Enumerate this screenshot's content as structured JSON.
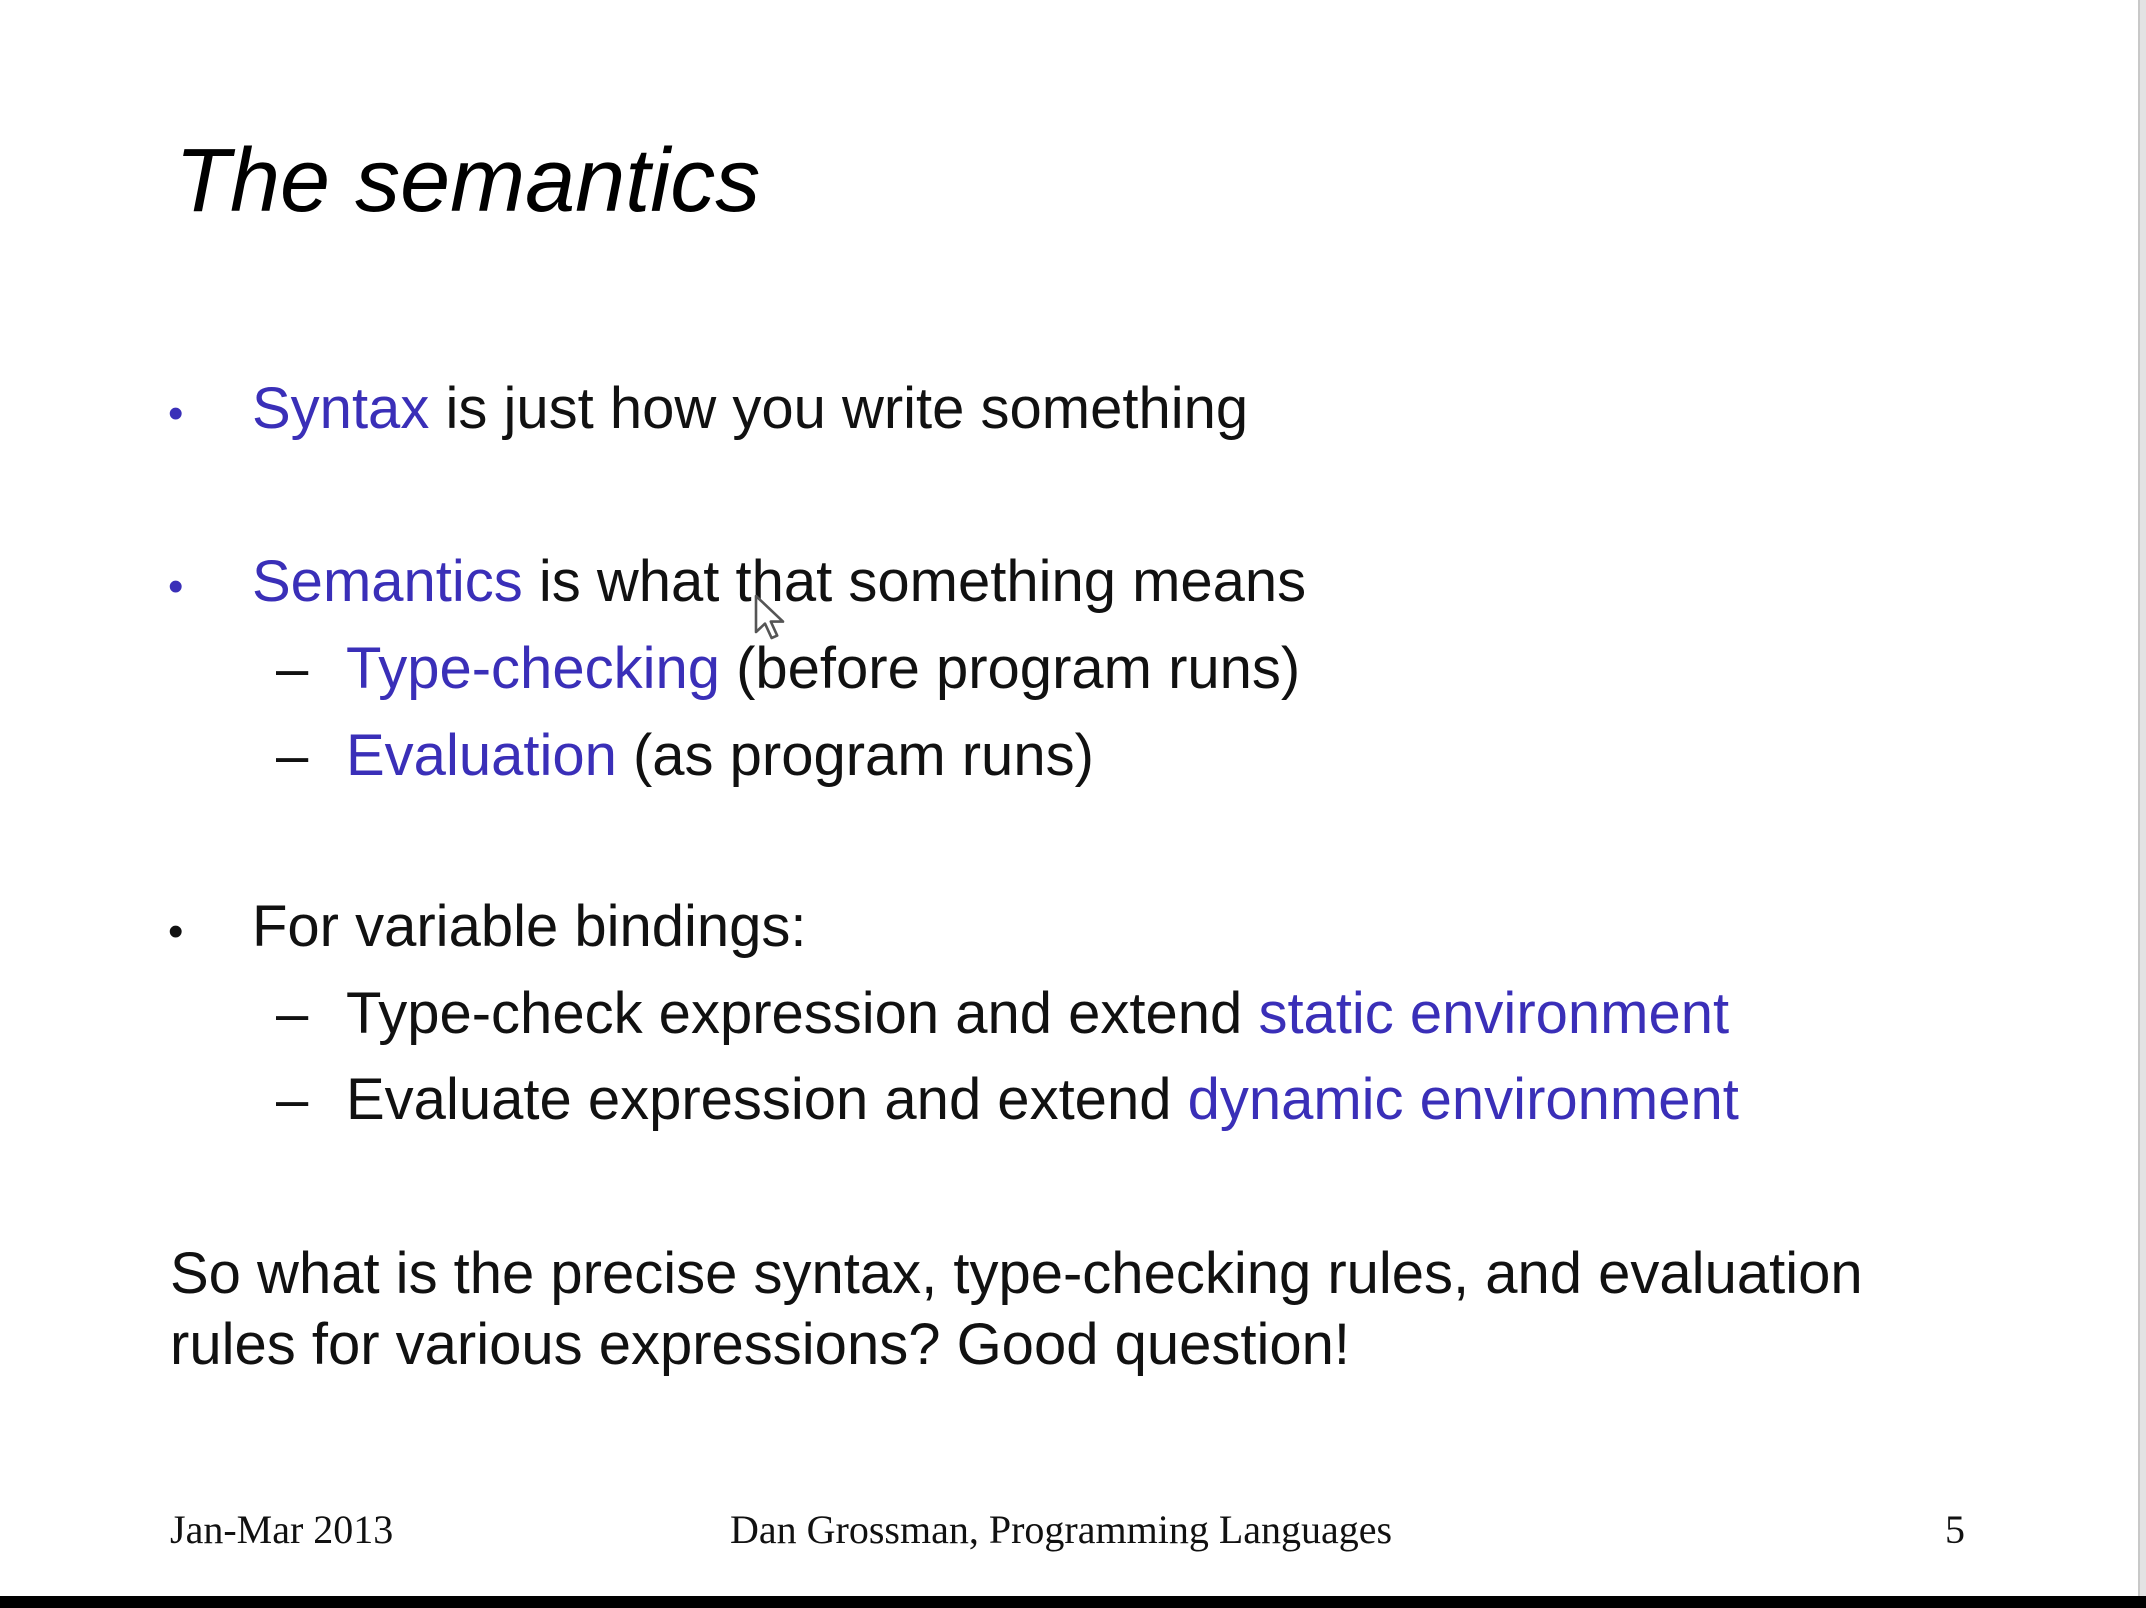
{
  "slide": {
    "title": "The semantics",
    "bullets": [
      {
        "accent_text": "Syntax",
        "rest_text": " is just how you write something"
      },
      {
        "accent_text": "Semantics",
        "rest_text": " is what that something means",
        "subitems": [
          {
            "accent_text": "Type-checking",
            "rest_text": " (before program runs)"
          },
          {
            "accent_text": "Evaluation",
            "rest_text": " (as program runs)"
          }
        ]
      },
      {
        "text": "For variable bindings:",
        "subitems": [
          {
            "lead_text": "Type-check expression and extend ",
            "accent_text": "static environment"
          },
          {
            "lead_text": "Evaluate expression and extend ",
            "accent_text": "dynamic environment"
          }
        ]
      }
    ],
    "closing_lines": [
      "So what is the precise syntax, type-checking rules, and evaluation",
      "rules for various expressions?  Good question!"
    ],
    "bullet_glyph": "•",
    "dash_glyph": "–"
  },
  "footer": {
    "date": "Jan-Mar 2013",
    "course": "Dan Grossman, Programming Languages",
    "page_number": "5"
  },
  "colors": {
    "accent": "#3a2fb8",
    "text": "#111111",
    "background": "#ffffff"
  },
  "icons": {
    "cursor": "mouse-pointer-icon"
  }
}
